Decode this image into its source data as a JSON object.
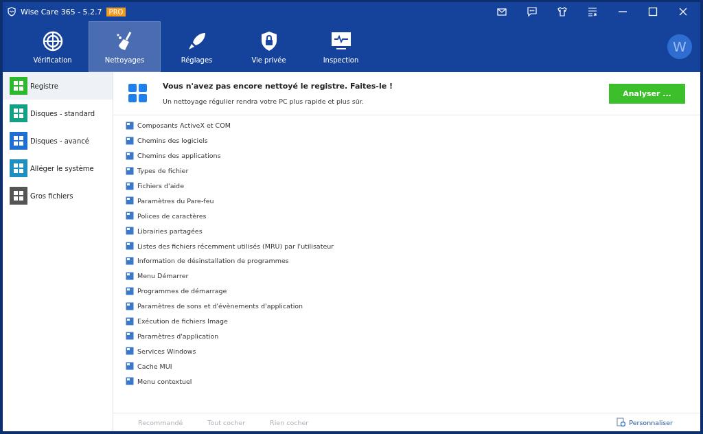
{
  "window": {
    "title": "Wise Care 365 - 5.2.7",
    "badge": "PRO"
  },
  "nav": [
    {
      "label": "Vérification",
      "selected": false
    },
    {
      "label": "Nettoyages",
      "selected": true
    },
    {
      "label": "Réglages",
      "selected": false
    },
    {
      "label": "Vie privée",
      "selected": false
    },
    {
      "label": "Inspection",
      "selected": false
    }
  ],
  "avatar": "W",
  "sidebar": {
    "items": [
      {
        "label": "Registre",
        "selected": true,
        "color": "#2eb82e"
      },
      {
        "label": "Disques - standard",
        "selected": false,
        "color": "#14a085"
      },
      {
        "label": "Disques - avancé",
        "selected": false,
        "color": "#1e6fd0"
      },
      {
        "label": "Alléger le système",
        "selected": false,
        "color": "#1f8fc0"
      },
      {
        "label": "Gros fichiers",
        "selected": false,
        "color": "#555555"
      }
    ]
  },
  "banner": {
    "title": "Vous n'avez pas encore nettoyé le registre. Faites-le !",
    "subtitle": "Un nettoyage régulier rendra votre PC plus rapide et plus sûr.",
    "button": "Analyser ..."
  },
  "items": [
    "Composants ActiveX et COM",
    "Chemins des logiciels",
    "Chemins des applications",
    "Types de fichier",
    "Fichiers d'aide",
    "Paramètres du Pare-feu",
    "Polices de caractères",
    "Librairies partagées",
    "Listes des fichiers récemment utilisés (MRU) par l'utilisateur",
    "Information de désinstallation de programmes",
    "Menu Démarrer",
    "Programmes de démarrage",
    "Paramètres de sons et d'évènements d'application",
    "Exécution de fichiers Image",
    "Paramètres d'application",
    "Services Windows",
    "Cache MUI",
    "Menu contextuel"
  ],
  "footer": {
    "links": [
      {
        "label": "Recommandé",
        "disabled": true
      },
      {
        "label": "Tout cocher",
        "disabled": true
      },
      {
        "label": "Rien cocher",
        "disabled": true
      }
    ],
    "customize": "Personnaliser"
  }
}
